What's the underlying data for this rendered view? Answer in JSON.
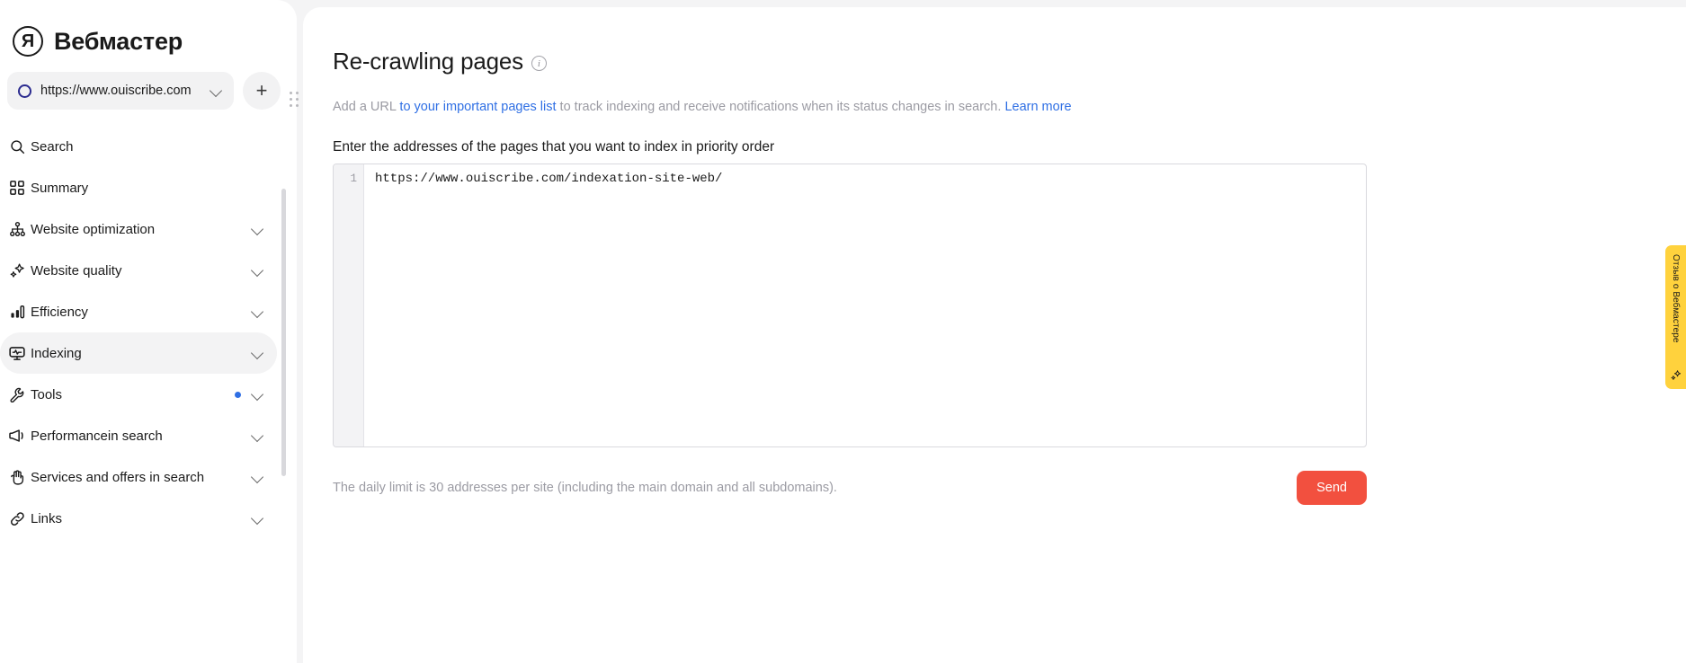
{
  "brand": {
    "logo_glyph": "Я",
    "name": "Вебмастер"
  },
  "site_selector": {
    "url": "https://www.ouiscribe.com",
    "chevron_icon": "chevron-down-icon",
    "add_label": "+"
  },
  "sidebar": {
    "items": [
      {
        "label": "Search",
        "icon": "search-icon",
        "expandable": false,
        "active": false,
        "dot": false
      },
      {
        "label": "Summary",
        "icon": "grid-icon",
        "expandable": false,
        "active": false,
        "dot": false
      },
      {
        "label": "Website optimization",
        "icon": "sitemap-icon",
        "expandable": true,
        "active": false,
        "dot": false
      },
      {
        "label": "Website quality",
        "icon": "star-spark-icon",
        "expandable": true,
        "active": false,
        "dot": false
      },
      {
        "label": "Efficiency",
        "icon": "bar-chart-icon",
        "expandable": true,
        "active": false,
        "dot": false
      },
      {
        "label": "Indexing",
        "icon": "monitor-pulse-icon",
        "expandable": true,
        "active": true,
        "dot": false
      },
      {
        "label": "Tools",
        "icon": "wrench-icon",
        "expandable": true,
        "active": false,
        "dot": true
      },
      {
        "label": "Performancein search",
        "icon": "megaphone-icon",
        "expandable": true,
        "active": false,
        "dot": false
      },
      {
        "label": "Services and offers in search",
        "icon": "hand-icon",
        "expandable": true,
        "active": false,
        "dot": false
      },
      {
        "label": "Links",
        "icon": "link-icon",
        "expandable": true,
        "active": false,
        "dot": false
      }
    ]
  },
  "page": {
    "title": "Re-crawling pages",
    "info_icon": "info-icon",
    "subtitle_part1": "Add a URL ",
    "subtitle_link1": "to your important pages list",
    "subtitle_part2": " to track indexing and receive notifications when its status changes in search. ",
    "subtitle_link2": "Learn more"
  },
  "form": {
    "field_label": "Enter the addresses of the pages that you want to index in priority order",
    "line_number": "1",
    "value": "https://www.ouiscribe.com/indexation-site-web/",
    "placeholder": "",
    "limit_note": "The daily limit is 30 addresses per site (including the main domain and all subdomains).",
    "send_label": "Send"
  },
  "feedback_tab": {
    "text": "Отзыв о Вебмастере",
    "icon": "spark-icon",
    "color": "#ffd23d"
  },
  "colors": {
    "accent_link": "#2f6fe4",
    "send_button": "#f2503f",
    "muted_text": "#9b9ba3",
    "feedback": "#ffd23d"
  }
}
